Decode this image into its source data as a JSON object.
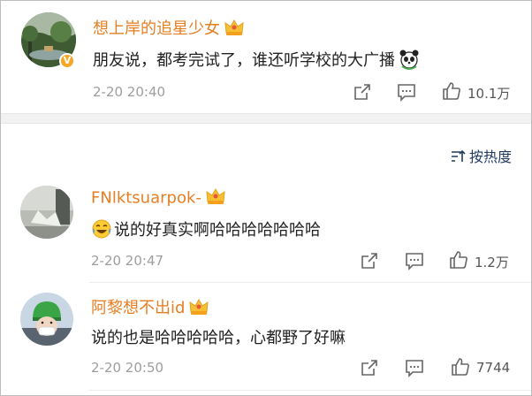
{
  "top_comment": {
    "username": "想上岸的追星少女",
    "text": "朋友说，都考完试了，谁还听学校的大广播",
    "time": "2-20 20:40",
    "likes": "10.1万",
    "verified_badge": "V",
    "avatar_icon": "forest-lake-avatar",
    "emoji_icon": "panda-emoji"
  },
  "sort": {
    "label": "按热度",
    "icon": "sort-icon"
  },
  "replies": [
    {
      "username": "FNlktsuarpok-",
      "text": "说的好真实啊哈哈哈哈哈哈哈",
      "time": "2-20 20:47",
      "likes": "1.2万",
      "avatar_icon": "grey-photo-avatar",
      "emoji_icon": "laughing-tears-emoji"
    },
    {
      "username": "阿黎想不出id",
      "text": "说的也是哈哈哈哈哈，心都野了好嘛",
      "time": "2-20 20:50",
      "likes": "7744",
      "avatar_icon": "helmet-person-avatar"
    }
  ],
  "colors": {
    "username": "#e67e22",
    "text": "#222222",
    "meta": "#9e9e9e",
    "sort": "#1f3a5f",
    "divider": "#f2f2f2"
  }
}
